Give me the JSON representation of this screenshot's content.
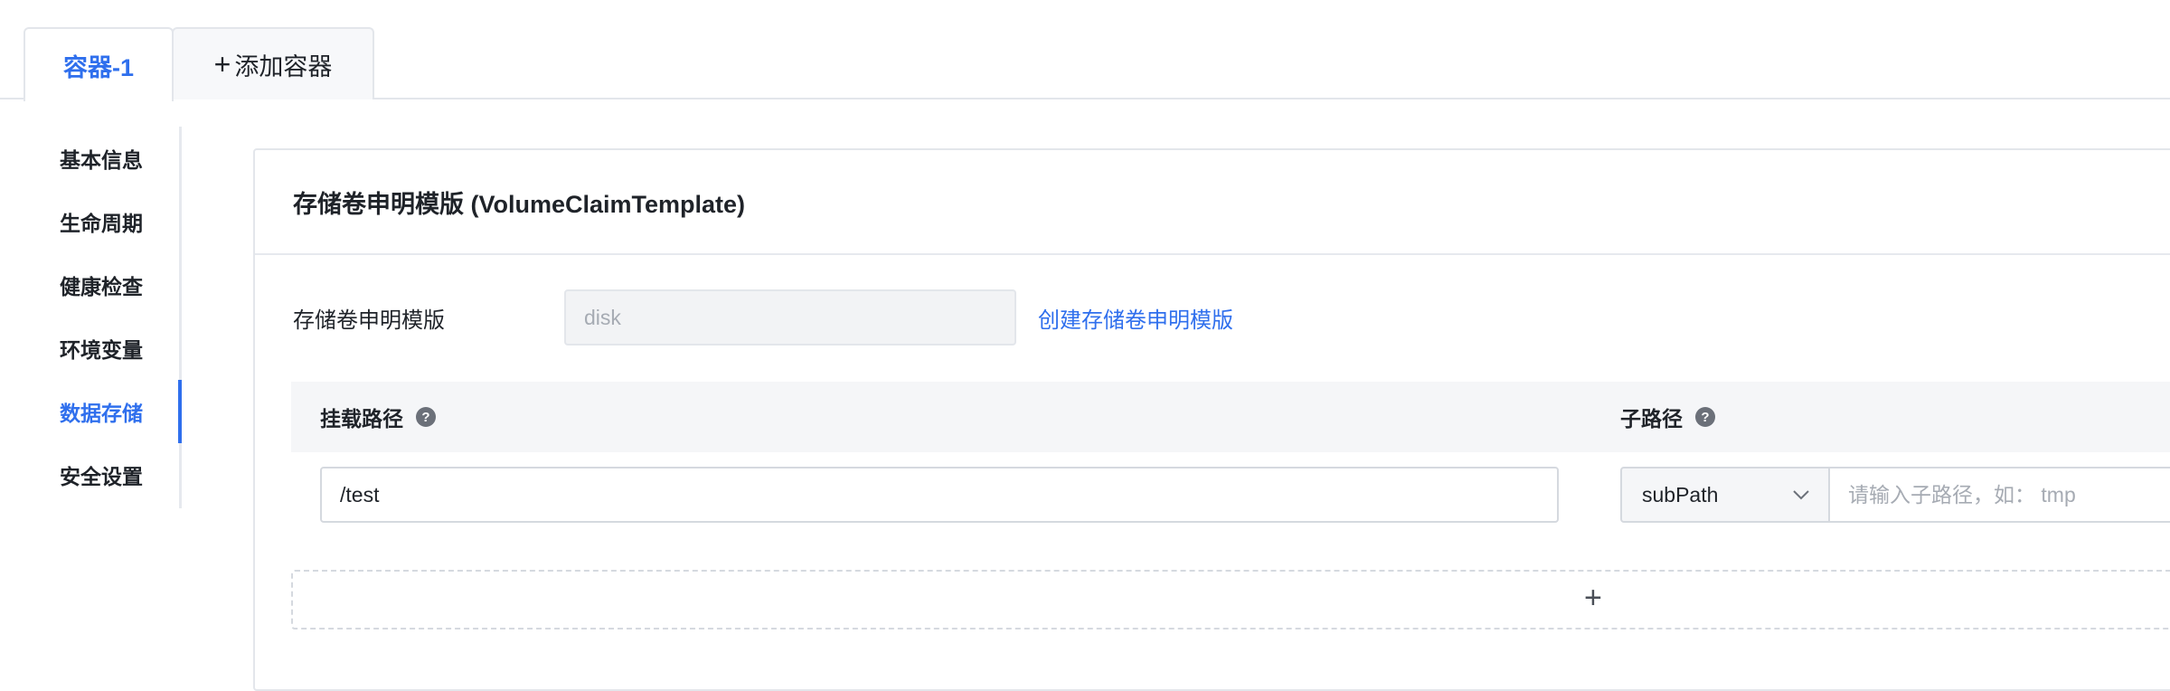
{
  "tabs": [
    {
      "label": "容器-1",
      "active": true
    },
    {
      "label": "添加容器",
      "icon": "plus-icon"
    }
  ],
  "sidebar": {
    "items": [
      {
        "label": "基本信息"
      },
      {
        "label": "生命周期"
      },
      {
        "label": "健康检查"
      },
      {
        "label": "环境变量"
      },
      {
        "label": "数据存储",
        "active": true
      },
      {
        "label": "安全设置"
      }
    ]
  },
  "panel": {
    "title": "存储卷申明模版 (VolumeClaimTemplate)",
    "template_label": "存储卷申明模版",
    "template_value": "disk",
    "create_link": "创建存储卷申明模版",
    "columns": {
      "mount_path": "挂载路径",
      "sub_path": "子路径",
      "help_icon": "?"
    },
    "mount_path_value": "/test",
    "sub_path_type": "subPath",
    "sub_path_placeholder": "请输入子路径，如： tmp",
    "add_button": "+"
  },
  "colors": {
    "accent": "#2f6fed",
    "border": "#e3e6eb",
    "header_bg": "#f5f6f8"
  }
}
